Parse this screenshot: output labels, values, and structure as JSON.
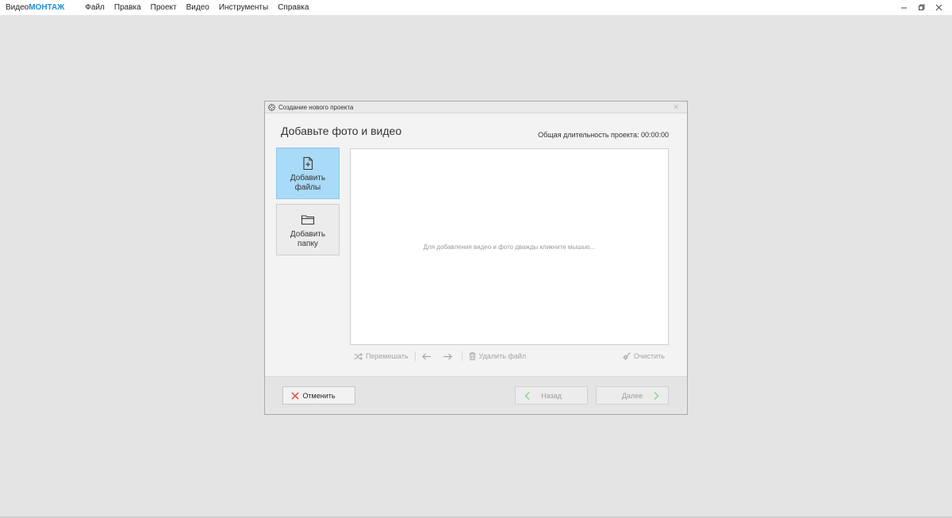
{
  "app": {
    "title_prefix": "Видео",
    "title_accent": "МОНТАЖ",
    "accent_color": "#1c8fd6"
  },
  "menu": [
    {
      "label": "Файл"
    },
    {
      "label": "Правка"
    },
    {
      "label": "Проект"
    },
    {
      "label": "Видео"
    },
    {
      "label": "Инструменты"
    },
    {
      "label": "Справка"
    }
  ],
  "window_controls": {
    "minimize_icon": "minimize-icon",
    "restore_icon": "restore-icon",
    "close_icon": "close-icon"
  },
  "dialog": {
    "title": "Создание нового проекта",
    "heading": "Добавьте фото и видео",
    "duration_label": "Общая длительность проекта: 00:00:00",
    "add_files_label": "Добавить файлы",
    "add_folder_label": "Добавить папку",
    "drop_hint": "Для добавления видео и фото дважды кликните мышью...",
    "toolbar": {
      "shuffle_label": "Перемешать",
      "delete_label": "Удалить файл",
      "clear_label": "Очистить"
    },
    "footer": {
      "cancel_label": "Отменить",
      "back_label": "Назад",
      "next_label": "Далее"
    },
    "colors": {
      "active_button": "#a9daf7",
      "cancel_icon": "#e05a4f",
      "nav_arrow": "#8fd48a"
    }
  }
}
